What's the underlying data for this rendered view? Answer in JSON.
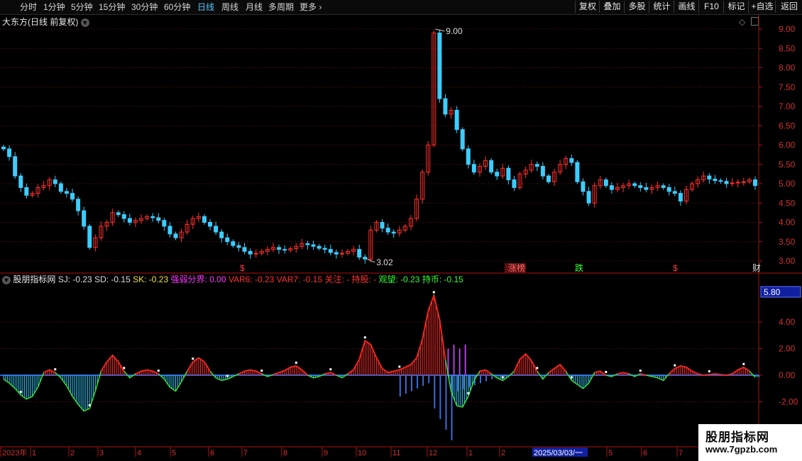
{
  "toolbar": {
    "periods": [
      "分时",
      "1分钟",
      "5分钟",
      "15分钟",
      "30分钟",
      "60分钟",
      "日线",
      "周线",
      "月线",
      "多周期",
      "更多"
    ],
    "active_period": "日线",
    "buttons": [
      "复权",
      "叠加",
      "多股",
      "统计",
      "画线",
      "F10",
      "标记",
      "+自选",
      "返回"
    ]
  },
  "main_panel": {
    "title": "大东方(日线 前复权)",
    "high_label": "9.00",
    "low_label": "3.02",
    "event_markers": [
      {
        "text": "$",
        "color": "#ff3b3b"
      },
      {
        "text": "涨榜",
        "color": "#ff6a6a"
      },
      {
        "text": "跌",
        "color": "#3cff3c"
      },
      {
        "text": "$",
        "color": "#ff3b3b"
      },
      {
        "text": "财",
        "color": "#dcdcdc"
      }
    ],
    "y_ticks": [
      "9.00",
      "8.50",
      "8.00",
      "7.50",
      "7.00",
      "6.50",
      "6.00",
      "5.50",
      "5.00",
      "4.50",
      "4.00",
      "3.50",
      "3.00"
    ]
  },
  "indicator_panel": {
    "name": "股朋指标网",
    "items": [
      {
        "label": "SJ: -0.23",
        "color": "#dcdcdc"
      },
      {
        "label": "SD: -0.15",
        "color": "#dcdcdc"
      },
      {
        "label": "SK: -0.23",
        "color": "#f0e040"
      },
      {
        "label": "强弱分界: 0.00",
        "color": "#ff33ff"
      },
      {
        "label": "VAR6: -0.23",
        "color": "#ff3030"
      },
      {
        "label": "VAR7: -0.15",
        "color": "#ff3030"
      },
      {
        "label": "关注: -",
        "color": "#ff3030"
      },
      {
        "label": "持股: -",
        "color": "#ff3030"
      },
      {
        "label": "观望: -0.23",
        "color": "#33ff33"
      },
      {
        "label": "持币: -0.15",
        "color": "#33ff33"
      }
    ],
    "cursor_value": "5.80",
    "y_ticks": [
      "4.00",
      "2.00",
      "0.00",
      "-2.00"
    ]
  },
  "x_axis": {
    "labels": [
      "2023年",
      "1",
      "2",
      "3",
      "4",
      "5",
      "6",
      "7",
      "8",
      "9",
      "10",
      "11",
      "12",
      "1",
      "2",
      "2025/03/03/一",
      "5",
      "6",
      "7"
    ]
  },
  "watermark": {
    "line1": "股朋指标网",
    "line2": "www.7gpzb.com"
  },
  "chart_data": [
    {
      "type": "candlestick",
      "title": "大东方(日线 前复权)",
      "ylim": [
        2.9,
        9.2
      ],
      "price_series": [
        5.9,
        5.7,
        5.2,
        4.9,
        4.7,
        4.75,
        4.9,
        4.95,
        5.1,
        5.0,
        4.8,
        4.75,
        4.6,
        4.3,
        3.9,
        3.35,
        3.6,
        3.9,
        4.0,
        4.25,
        4.2,
        4.1,
        4.0,
        4.05,
        4.1,
        4.15,
        4.12,
        4.05,
        3.9,
        3.7,
        3.6,
        3.75,
        3.95,
        4.1,
        4.15,
        4.0,
        3.9,
        3.75,
        3.6,
        3.5,
        3.4,
        3.35,
        3.25,
        3.18,
        3.2,
        3.25,
        3.3,
        3.35,
        3.3,
        3.28,
        3.32,
        3.38,
        3.45,
        3.42,
        3.38,
        3.33,
        3.3,
        3.22,
        3.18,
        3.2,
        3.25,
        3.3,
        3.1,
        3.05,
        3.8,
        4.0,
        3.85,
        3.75,
        3.72,
        3.8,
        3.9,
        4.1,
        4.6,
        5.3,
        6.0,
        8.9,
        7.2,
        6.8,
        6.9,
        6.4,
        5.9,
        5.5,
        5.3,
        5.45,
        5.6,
        5.3,
        5.2,
        5.4,
        5.1,
        4.9,
        5.25,
        5.35,
        5.5,
        5.45,
        5.2,
        5.05,
        5.3,
        5.5,
        5.65,
        5.55,
        5.05,
        4.8,
        4.5,
        4.95,
        5.1,
        4.95,
        4.85,
        4.9,
        4.95,
        5.0,
        4.95,
        4.9,
        4.85,
        4.9,
        4.95,
        4.9,
        4.8,
        4.75,
        4.55,
        4.85,
        5.0,
        5.1,
        5.2,
        5.12,
        5.08,
        5.06,
        5.0,
        5.02,
        5.04,
        5.05,
        5.1,
        4.95
      ],
      "high": 9.0,
      "low": 3.02,
      "x_month_labels": [
        "2023年",
        "1",
        "2",
        "3",
        "4",
        "5",
        "6",
        "7",
        "8",
        "9",
        "10",
        "11",
        "12",
        "1",
        "2",
        "2025/03/03/一",
        "5",
        "6",
        "7"
      ]
    },
    {
      "type": "bar",
      "title": "股朋指标网",
      "ylim": [
        -3.5,
        6.4
      ],
      "zero_line": 0.0,
      "values": [
        -0.3,
        -0.6,
        -1.0,
        -1.5,
        -1.8,
        -1.6,
        -0.9,
        0.2,
        0.4,
        0.2,
        -0.2,
        -0.8,
        -1.6,
        -2.2,
        -2.7,
        -2.5,
        -1.2,
        0.3,
        1.0,
        1.5,
        1.0,
        0.3,
        -0.2,
        0.1,
        0.3,
        0.4,
        0.3,
        0.1,
        -0.3,
        -0.9,
        -1.2,
        -0.5,
        0.3,
        1.0,
        1.3,
        1.0,
        0.3,
        -0.2,
        -0.4,
        -0.3,
        -0.1,
        0.1,
        0.3,
        0.4,
        0.3,
        0.1,
        -0.1,
        0.05,
        0.2,
        0.35,
        0.6,
        0.7,
        0.4,
        0.0,
        -0.2,
        -0.1,
        0.1,
        0.2,
        0.0,
        -0.2,
        0.1,
        0.4,
        1.2,
        2.6,
        2.3,
        1.3,
        0.5,
        0.2,
        0.3,
        0.4,
        0.6,
        0.8,
        1.3,
        2.7,
        4.8,
        6.0,
        4.2,
        1.2,
        -1.2,
        -2.3,
        -2.4,
        -1.6,
        -0.4,
        0.3,
        0.4,
        0.1,
        -0.2,
        -0.4,
        -0.1,
        0.3,
        1.2,
        1.6,
        1.1,
        0.3,
        -0.3,
        0.2,
        0.5,
        0.8,
        0.3,
        -0.4,
        -0.7,
        -1.0,
        -0.6,
        0.2,
        0.3,
        0.0,
        -0.1,
        0.1,
        0.2,
        0.1,
        -0.1,
        0.1,
        0.0,
        -0.1,
        -0.2,
        -0.4,
        0.1,
        0.5,
        0.7,
        0.6,
        0.3,
        0.1,
        0.0,
        0.05,
        0.1,
        0.05,
        0.0,
        0.1,
        0.4,
        0.6,
        0.3,
        -0.15
      ]
    }
  ],
  "colors": {
    "up": "#ff3030",
    "down": "#3ccdff",
    "blue_bar": "#3a6bd8",
    "purple_bar": "#b040e0",
    "grid": "#7a1010",
    "axis": "#b01010"
  }
}
